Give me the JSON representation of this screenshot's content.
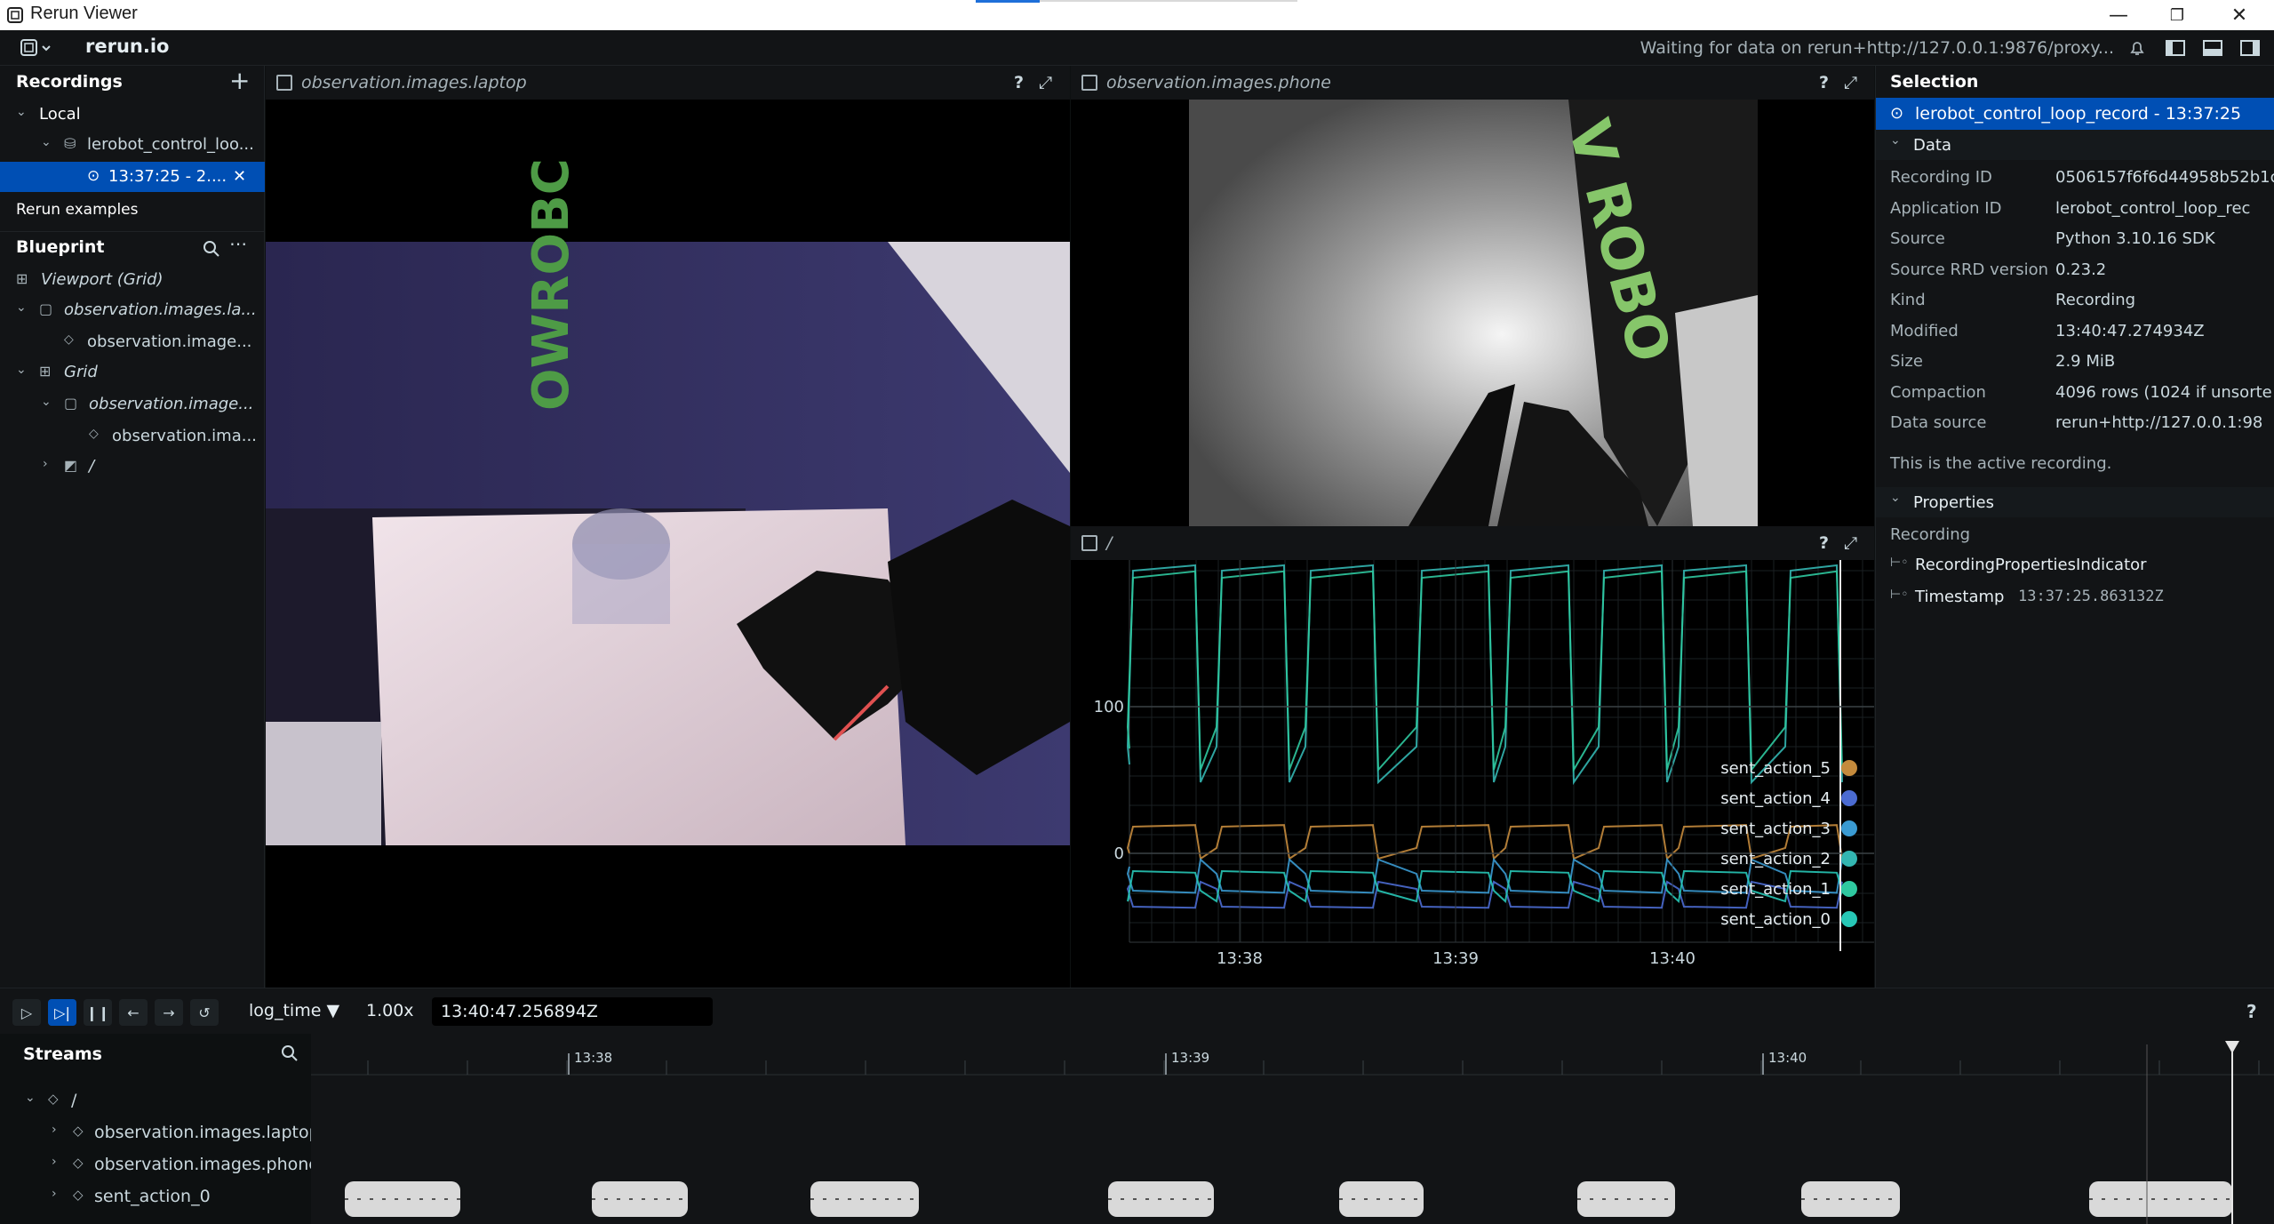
{
  "window": {
    "title": "Rerun Viewer",
    "minimize": "—",
    "restore": "❐",
    "close": "✕"
  },
  "topbar": {
    "brand": "rerun.io",
    "status": "Waiting for data on rerun+http://127.0.0.1:9876/proxy..."
  },
  "recordings": {
    "header": "Recordings",
    "local_label": "Local",
    "app_label": "lerobot_control_loo...",
    "recording_label": "13:37:25 - 2....",
    "examples_label": "Rerun examples"
  },
  "blueprint": {
    "header": "Blueprint",
    "items": [
      {
        "label": "Viewport (Grid)"
      },
      {
        "label": "observation.images.la..."
      },
      {
        "label": "observation.image..."
      },
      {
        "label": "Grid"
      },
      {
        "label": "observation.image..."
      },
      {
        "label": "observation.ima..."
      },
      {
        "label": "/"
      }
    ]
  },
  "views": {
    "laptop": {
      "title": "observation.images.laptop",
      "image_label": "OWROBC"
    },
    "phone": {
      "title": "observation.images.phone",
      "image_label": "V ROBO"
    },
    "plot": {
      "title": "/"
    },
    "help": "?",
    "maximize": "⤢"
  },
  "chart_data": {
    "type": "line",
    "title": "",
    "x_ticks": [
      "13:38",
      "13:39",
      "13:40"
    ],
    "y_ticks": [
      0,
      100
    ],
    "legend_position": "bottom-right",
    "series": [
      {
        "name": "sent_action_5",
        "color": "#c48a3c"
      },
      {
        "name": "sent_action_4",
        "color": "#4b6bd1"
      },
      {
        "name": "sent_action_3",
        "color": "#3a9ad2"
      },
      {
        "name": "sent_action_2",
        "color": "#33b6b1"
      },
      {
        "name": "sent_action_1",
        "color": "#2fc9a0"
      },
      {
        "name": "sent_action_0",
        "color": "#27c7b6"
      }
    ]
  },
  "selection": {
    "header": "Selection",
    "selected": "lerobot_control_loop_record - 13:37:25",
    "data_header": "Data",
    "rows": [
      {
        "k": "Recording ID",
        "v": "0506157f6f6d44958b52b1c"
      },
      {
        "k": "Application ID",
        "v": "lerobot_control_loop_rec"
      },
      {
        "k": "Source",
        "v": "Python 3.10.16 SDK"
      },
      {
        "k": "Source RRD version",
        "v": "0.23.2"
      },
      {
        "k": "Kind",
        "v": "Recording"
      },
      {
        "k": "Modified",
        "v": "13:40:47.274934Z"
      },
      {
        "k": "Size",
        "v": "2.9 MiB"
      },
      {
        "k": "Compaction",
        "v": "4096 rows (1024 if unsorte"
      },
      {
        "k": "Data source",
        "v": "rerun+http://127.0.0.1:98"
      }
    ],
    "note": "This is the active recording.",
    "properties_header": "Properties",
    "prop_group": "Recording",
    "prop_indicator": "RecordingPropertiesIndicator",
    "prop_timestamp_key": "Timestamp",
    "prop_timestamp_val": "13:37:25.863132Z"
  },
  "timebar": {
    "timeline": "log_time",
    "speed": "1.00x",
    "current_time": "13:40:47.256894Z",
    "help": "?"
  },
  "streams": {
    "header": "Streams",
    "root": "/",
    "items": [
      "observation.images.laptop",
      "observation.images.phone",
      "sent_action_0"
    ],
    "ticks": [
      "13:38",
      "13:39",
      "13:40"
    ]
  }
}
